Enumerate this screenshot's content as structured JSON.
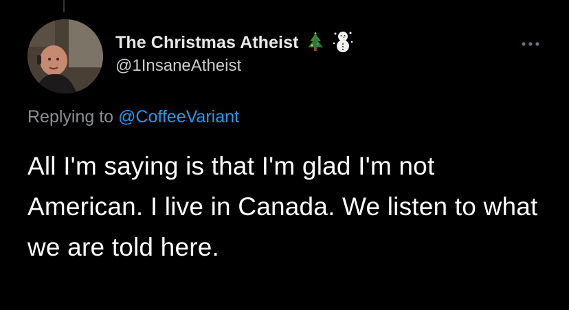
{
  "tweet": {
    "display_name": "The Christmas Atheist",
    "name_emojis": [
      "christmas-tree-icon",
      "snowman-icon"
    ],
    "handle": "@1InsaneAtheist",
    "reply_prefix": "Replying to",
    "reply_to": "@CoffeeVariant",
    "body": "All I'm saying is that I'm glad I'm not American. I live in Canada. We listen to what we are told here."
  },
  "colors": {
    "background": "#000000",
    "primary_text": "#ffffff",
    "secondary_text": "#8b9096",
    "link": "#1d9bf0"
  }
}
